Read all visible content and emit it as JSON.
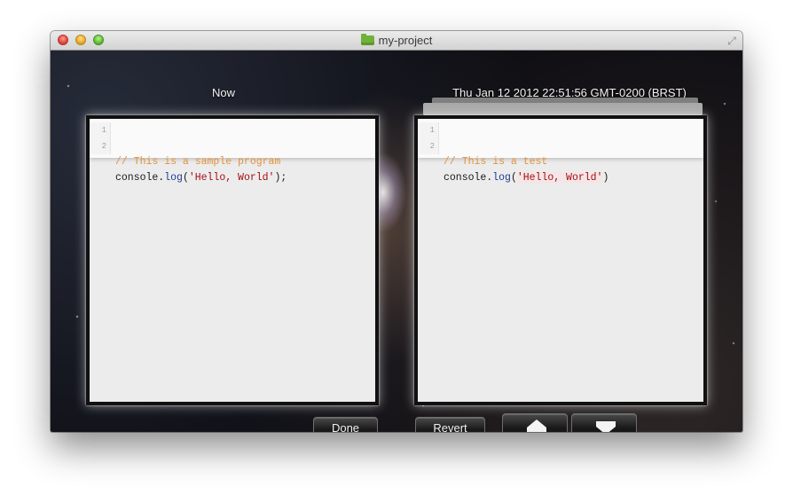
{
  "window": {
    "title": "my-project"
  },
  "left_pane": {
    "label": "Now",
    "lines": [
      {
        "number": "1",
        "tokens": {
          "comment": "// This is a sample program"
        }
      },
      {
        "number": "2",
        "tokens": {
          "obj": "console.",
          "fn": "log",
          "open": "(",
          "str": "'Hello, World'",
          "close": ");"
        }
      }
    ]
  },
  "right_pane": {
    "label": "Thu Jan 12 2012 22:51:56 GMT-0200 (BRST)",
    "lines": [
      {
        "number": "1",
        "tokens": {
          "comment": "// This is a test"
        }
      },
      {
        "number": "2",
        "tokens": {
          "obj": "console.",
          "fn": "log",
          "open": "(",
          "str": "'Hello, World'",
          "close": ")"
        }
      }
    ]
  },
  "buttons": {
    "done": "Done",
    "revert": "Revert"
  },
  "icons": {
    "folder": "folder-icon",
    "fullscreen": "fullscreen-icon",
    "previous": "arrow-up-icon",
    "next": "arrow-down-icon"
  },
  "colors": {
    "comment": "#e2923d",
    "string": "#a50e13",
    "function": "#1d3d8f"
  }
}
